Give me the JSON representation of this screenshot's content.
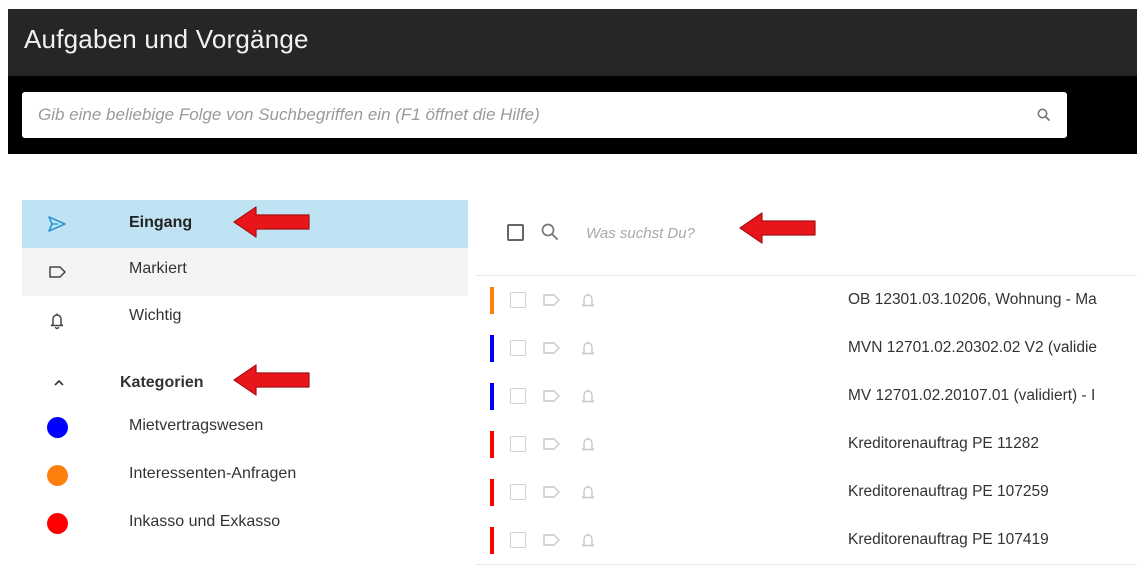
{
  "app": {
    "title": "Aufgaben und Vorgänge"
  },
  "search": {
    "placeholder": "Gib eine beliebige Folge von Suchbegriffen ein (F1 öffnet die Hilfe)",
    "value": ""
  },
  "sidebar": {
    "items": [
      {
        "label": "Eingang",
        "icon": "send-icon",
        "state": "active"
      },
      {
        "label": "Markiert",
        "icon": "label-icon"
      },
      {
        "label": "Wichtig",
        "icon": "bell-icon"
      }
    ],
    "categories_header": {
      "label": "Kategorien",
      "icon": "chevron-up-icon"
    },
    "categories": [
      {
        "label": "Mietvertragswesen",
        "color": "#0000ff"
      },
      {
        "label": "Interessenten-Anfragen",
        "color": "#ff7f0e"
      },
      {
        "label": "Inkasso und Exkasso",
        "color": "#ff0000"
      }
    ]
  },
  "main": {
    "filter": {
      "placeholder": "Was suchst Du?",
      "value": ""
    },
    "rows": [
      {
        "subject": "OB 12301.03.10206, Wohnung - Ma",
        "color": "#ff7f0e"
      },
      {
        "subject": "MVN 12701.02.20302.02 V2 (validie",
        "color": "#0000ff"
      },
      {
        "subject": "MV 12701.02.20107.01 (validiert) - I",
        "color": "#0000ff"
      },
      {
        "subject": "Kreditorenauftrag PE 11282",
        "color": "#ff0000"
      },
      {
        "subject": "Kreditorenauftrag PE 107259",
        "color": "#ff0000"
      },
      {
        "subject": "Kreditorenauftrag PE 107419",
        "color": "#ff0000"
      }
    ]
  },
  "colors": {
    "header_bg": "#262626",
    "selected_bg": "#bfe3f3",
    "arrow": "#e8161b"
  }
}
